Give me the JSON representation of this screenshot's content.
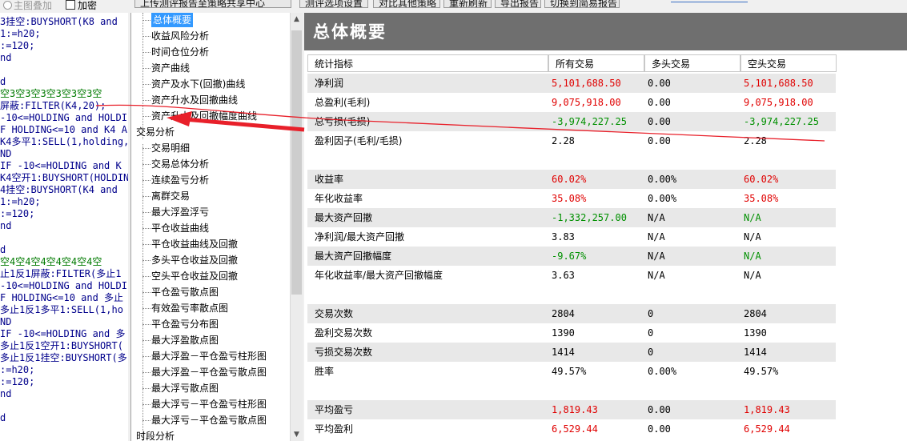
{
  "toolbar": {
    "upload_label": "上传测评报告至策略共享中心",
    "eval_label": "测评选项设置",
    "compare_label": "对比其他策略",
    "refresh_label": "重新刷新",
    "export_label": "导出报告",
    "switch_label": "切换到简易报告",
    "overlay_label": "主图叠加",
    "encrypt_label": "加密"
  },
  "code_lines": [
    "3挂空:BUYSHORT(K8    and",
    "1:=h20;",
    ":=120;",
    "nd",
    "",
    "d",
    "空3空3空3空3空3空3空",
    "屏蔽:FILTER(K4,20);",
    " -10<=HOLDING and HOLDI",
    "F HOLDING<=10 and  K4 A",
    "K4多平1:SELL(1,holding,",
    "ND",
    "IF -10<=HOLDING and  K",
    "K4空开1:BUYSHORT(HOLDIN",
    "4挂空:BUYSHORT(K4    and",
    "1:=h20;",
    ":=120;",
    "nd",
    "",
    "d",
    "空4空4空4空4空4空4空",
    "止1反1屏蔽:FILTER(多止1",
    " -10<=HOLDING and HOLDI",
    "F HOLDING<=10 and  多止",
    "多止1反1多平1:SELL(1,ho",
    "ND",
    "IF -10<=HOLDING and  多",
    "多止1反1空开1:BUYSHORT(",
    "多止1反1挂空:BUYSHORT(多",
    ":=h20;",
    ":=120;",
    "nd",
    "",
    "d"
  ],
  "tree": {
    "items": [
      {
        "label": "总体概要",
        "selected": true
      },
      {
        "label": "收益风险分析"
      },
      {
        "label": "时间仓位分析"
      },
      {
        "label": "资产曲线"
      },
      {
        "label": "资产及水下(回撤)曲线"
      },
      {
        "label": "资产升水及回撤曲线"
      },
      {
        "label": "资产升水及回撤幅度曲线"
      },
      {
        "label": "交易分析",
        "group": true
      },
      {
        "label": "交易明细"
      },
      {
        "label": "交易总体分析"
      },
      {
        "label": "连续盈亏分析"
      },
      {
        "label": "离群交易"
      },
      {
        "label": "最大浮盈浮亏"
      },
      {
        "label": "平仓收益曲线"
      },
      {
        "label": "平仓收益曲线及回撤"
      },
      {
        "label": "多头平仓收益及回撤"
      },
      {
        "label": "空头平仓收益及回撤"
      },
      {
        "label": "平仓盈亏散点图"
      },
      {
        "label": "有效盈亏率散点图"
      },
      {
        "label": "平仓盈亏分布图"
      },
      {
        "label": "最大浮盈散点图"
      },
      {
        "label": "最大浮盈－平仓盈亏柱形图"
      },
      {
        "label": "最大浮盈－平仓盈亏散点图"
      },
      {
        "label": "最大浮亏散点图"
      },
      {
        "label": "最大浮亏－平仓盈亏柱形图"
      },
      {
        "label": "最大浮亏－平仓盈亏散点图"
      },
      {
        "label": "时段分析",
        "group": true
      }
    ]
  },
  "report": {
    "title": "总体概要",
    "headers": [
      "统计指标",
      "所有交易",
      "多头交易",
      "空头交易"
    ],
    "rows": [
      {
        "name": "净利润",
        "all": "5,101,688.50",
        "long": "0.00",
        "short": "5,101,688.50",
        "color": "red",
        "shade": true
      },
      {
        "name": "总盈利(毛利)",
        "all": "9,075,918.00",
        "long": "0.00",
        "short": "9,075,918.00",
        "color": "red"
      },
      {
        "name": "总亏损(毛损)",
        "all": "-3,974,227.25",
        "long": "0.00",
        "short": "-3,974,227.25",
        "color": "green",
        "shade": true
      },
      {
        "name": "盈利因子(毛利/毛损)",
        "all": "2.28",
        "long": "0.00",
        "short": "2.28",
        "color": ""
      },
      {
        "name": "收益率",
        "all": "60.02%",
        "long": "0.00%",
        "short": "60.02%",
        "color": "red",
        "shade": true,
        "gap": true
      },
      {
        "name": "年化收益率",
        "all": "35.08%",
        "long": "0.00%",
        "short": "35.08%",
        "color": "red"
      },
      {
        "name": "最大资产回撤",
        "all": "-1,332,257.00",
        "long": "N/A",
        "short": "N/A",
        "color": "green",
        "shade": true
      },
      {
        "name": "净利润/最大资产回撤",
        "all": "3.83",
        "long": "N/A",
        "short": "N/A",
        "color": ""
      },
      {
        "name": "最大资产回撤幅度",
        "all": "-9.67%",
        "long": "N/A",
        "short": "N/A",
        "color": "green",
        "shade": true
      },
      {
        "name": "年化收益率/最大资产回撤幅度",
        "all": "3.63",
        "long": "N/A",
        "short": "N/A",
        "color": ""
      },
      {
        "name": "交易次数",
        "all": "2804",
        "long": "0",
        "short": "2804",
        "color": "",
        "shade": true,
        "gap": true
      },
      {
        "name": "盈利交易次数",
        "all": "1390",
        "long": "0",
        "short": "1390",
        "color": ""
      },
      {
        "name": "亏损交易次数",
        "all": "1414",
        "long": "0",
        "short": "1414",
        "color": "",
        "shade": true
      },
      {
        "name": "胜率",
        "all": "49.57%",
        "long": "0.00%",
        "short": "49.57%",
        "color": ""
      },
      {
        "name": "平均盈亏",
        "all": "1,819.43",
        "long": "0.00",
        "short": "1,819.43",
        "color": "red",
        "shade": true,
        "gap": true
      },
      {
        "name": "平均盈利",
        "all": "6,529.44",
        "long": "0.00",
        "short": "6,529.44",
        "color": "red"
      }
    ]
  },
  "annotation_color": "#e8202a"
}
